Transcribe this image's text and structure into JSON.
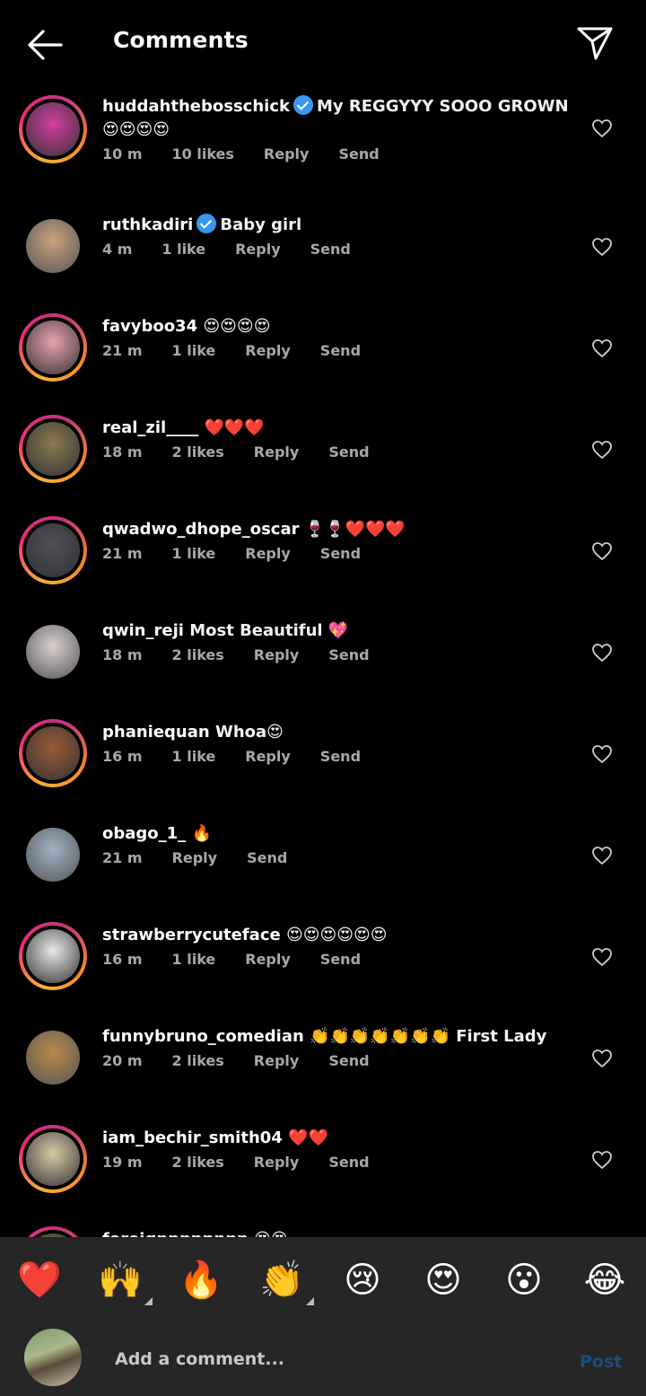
{
  "header": {
    "title": "Comments",
    "back_icon": "arrow-left-icon",
    "send_icon": "paper-plane-icon"
  },
  "comments": [
    {
      "username": "huddahthebosschick",
      "verified": true,
      "text": "My REGGYYY SOOO GROWN 😍😍😍😍",
      "time": "10 m",
      "likes": "10 likes",
      "reply": "Reply",
      "send": "Send",
      "ring": true,
      "avatar_color": "#d43ea0"
    },
    {
      "username": "ruthkadiri",
      "verified": true,
      "text": "Baby girl",
      "time": "4 m",
      "likes": "1 like",
      "reply": "Reply",
      "send": "Send",
      "ring": false,
      "avatar_color": "#c9a27f"
    },
    {
      "username": "favyboo34",
      "verified": false,
      "text": "😍😍😍😍",
      "time": "21 m",
      "likes": "1 like",
      "reply": "Reply",
      "send": "Send",
      "ring": true,
      "avatar_color": "#e8a2b0"
    },
    {
      "username": "real_zil____",
      "verified": false,
      "text": "❤️❤️❤️",
      "time": "18 m",
      "likes": "2 likes",
      "reply": "Reply",
      "send": "Send",
      "ring": true,
      "avatar_color": "#8a7a52"
    },
    {
      "username": "qwadwo_dhope_oscar",
      "verified": false,
      "text": "🍷🍷❤️❤️❤️",
      "time": "21 m",
      "likes": "1 like",
      "reply": "Reply",
      "send": "Send",
      "ring": true,
      "avatar_color": "#4e4f57"
    },
    {
      "username": "qwin_reji",
      "verified": false,
      "text": "Most Beautiful 💖",
      "time": "18 m",
      "likes": "2 likes",
      "reply": "Reply",
      "send": "Send",
      "ring": false,
      "avatar_color": "#d9cfcf"
    },
    {
      "username": "phaniequan",
      "verified": false,
      "text": "Whoa😍",
      "time": "16 m",
      "likes": "1 like",
      "reply": "Reply",
      "send": "Send",
      "ring": true,
      "avatar_color": "#9a5a38"
    },
    {
      "username": "obago_1_",
      "verified": false,
      "text": "🔥",
      "time": "21 m",
      "likes": "",
      "reply": "Reply",
      "send": "Send",
      "ring": false,
      "avatar_color": "#9fb2c4"
    },
    {
      "username": "strawberrycuteface",
      "verified": false,
      "text": "😍😍😍😍😍😍",
      "time": "16 m",
      "likes": "1 like",
      "reply": "Reply",
      "send": "Send",
      "ring": true,
      "avatar_color": "#e8e8e8"
    },
    {
      "username": "funnybruno_comedian",
      "verified": false,
      "text": "👏👏👏👏👏👏👏 First Lady",
      "time": "20 m",
      "likes": "2 likes",
      "reply": "Reply",
      "send": "Send",
      "ring": false,
      "avatar_color": "#b88a4a"
    },
    {
      "username": "iam_bechir_smith04",
      "verified": false,
      "text": "❤️❤️",
      "time": "19 m",
      "likes": "2 likes",
      "reply": "Reply",
      "send": "Send",
      "ring": true,
      "avatar_color": "#d9c8a8"
    },
    {
      "username": "foreignnnnnnnn",
      "verified": false,
      "text": "😍😍",
      "time": "",
      "likes": "",
      "reply": "",
      "send": "",
      "ring": true,
      "avatar_color": "#6a7a5a"
    }
  ],
  "reactions": [
    {
      "emoji": "❤️",
      "more": false
    },
    {
      "emoji": "🙌",
      "more": true
    },
    {
      "emoji": "🔥",
      "more": false
    },
    {
      "emoji": "👏",
      "more": true
    },
    {
      "emoji": "😢",
      "more": false
    },
    {
      "emoji": "😍",
      "more": false
    },
    {
      "emoji": "😮",
      "more": false
    },
    {
      "emoji": "😂",
      "more": false
    }
  ],
  "composer": {
    "placeholder": "Add a comment...",
    "post_label": "Post"
  },
  "colors": {
    "background": "#000000",
    "meta_text": "#a8a8a8",
    "verified": "#3897f0",
    "post_disabled": "#1d4d7a",
    "composer_bg": "#262626"
  }
}
